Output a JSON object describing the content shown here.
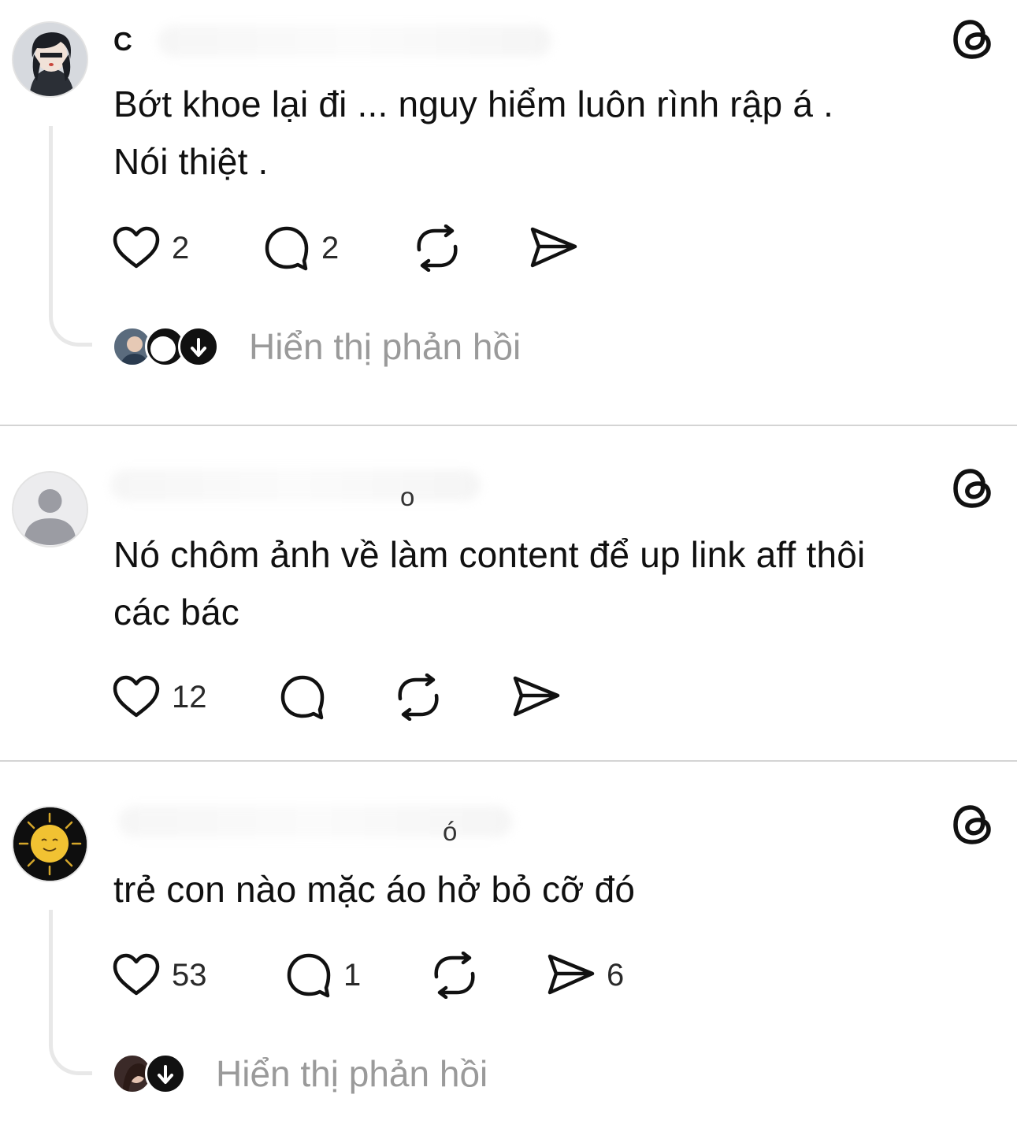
{
  "posts": [
    {
      "username": "C",
      "text_line1": "Bớt khoe lại đi ... nguy hiểm luôn rình rập á .",
      "text_line2": "Nói thiệt .",
      "likes": "2",
      "comments": "2",
      "shares": "",
      "show_replies": "Hiển thị phản hồi"
    },
    {
      "username": "o",
      "text_line1": "Nó chôm ảnh về làm content để up link aff thôi",
      "text_line2": "các bác",
      "likes": "12",
      "comments": "",
      "shares": ""
    },
    {
      "username": "ó",
      "text_line1": "trẻ con nào mặc áo hở bỏ cỡ đó",
      "likes": "53",
      "comments": "1",
      "shares": "6",
      "show_replies": "Hiển thị phản hồi"
    }
  ],
  "icons": {
    "like": "heart-icon",
    "comment": "comment-bubble-icon",
    "repost": "repost-icon",
    "share": "send-icon",
    "logo": "threads-logo-icon"
  }
}
